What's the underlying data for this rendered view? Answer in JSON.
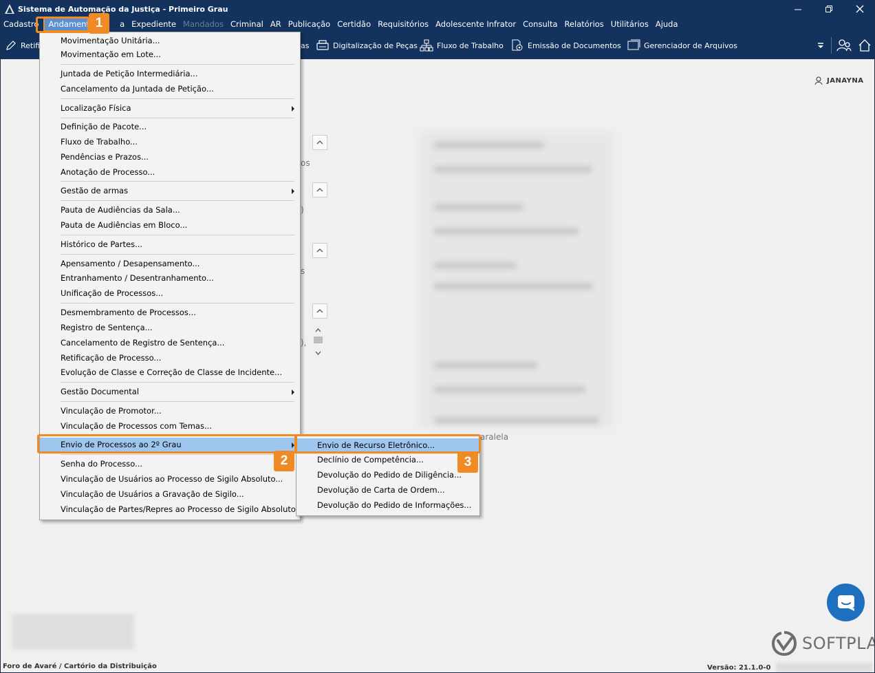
{
  "window": {
    "title": "Sistema de Automação da Justiça - Primeiro Grau",
    "minimize_icon": "minimize-icon",
    "restore_icon": "restore-icon",
    "close_icon": "close-icon"
  },
  "menubar": {
    "items": [
      {
        "label": "Cadastro",
        "state": "normal"
      },
      {
        "label": "Andamento",
        "state": "active"
      },
      {
        "label": "a",
        "state": "normal"
      },
      {
        "label": "Expediente",
        "state": "normal"
      },
      {
        "label": "Mandados",
        "state": "disabled"
      },
      {
        "label": "Criminal",
        "state": "normal"
      },
      {
        "label": "AR",
        "state": "normal"
      },
      {
        "label": "Publicação",
        "state": "normal"
      },
      {
        "label": "Certidão",
        "state": "normal"
      },
      {
        "label": "Requisitórios",
        "state": "normal"
      },
      {
        "label": "Adolescente Infrator",
        "state": "normal"
      },
      {
        "label": "Consulta",
        "state": "normal"
      },
      {
        "label": "Relatórios",
        "state": "normal"
      },
      {
        "label": "Utilitários",
        "state": "normal"
      },
      {
        "label": "Ajuda",
        "state": "normal"
      }
    ]
  },
  "toolbar": {
    "retif_label": "Retifi",
    "partial_label": "as",
    "digitalizacao_label": "Digitalização de Peças",
    "fluxo_label": "Fluxo de Trabalho",
    "emissao_label": "Emissão de Documentos",
    "gerenciador_label": "Gerenciador de Arquivos"
  },
  "user": {
    "name": "JANAYNA"
  },
  "background_fragments": {
    "frag1": "os",
    "frag2": ")",
    "frag3": "s",
    "frag4": "),",
    "frag5": "aralela"
  },
  "andamento_menu": {
    "items": [
      {
        "label": "Movimentação Unitária...",
        "submenu": false
      },
      {
        "label": "Movimentação em Lote...",
        "submenu": false
      },
      {
        "label": "Juntada de Petição Intermediária...",
        "submenu": false
      },
      {
        "label": "Cancelamento da Juntada de Petição...",
        "submenu": false
      },
      {
        "label": "Localização Física",
        "submenu": true
      },
      {
        "label": "Definição de Pacote...",
        "submenu": false
      },
      {
        "label": "Fluxo de Trabalho...",
        "submenu": false
      },
      {
        "label": "Pendências e Prazos...",
        "submenu": false
      },
      {
        "label": "Anotação de Processo...",
        "submenu": false
      },
      {
        "label": "Gestão de armas",
        "submenu": true
      },
      {
        "label": "Pauta de Audiências da Sala...",
        "submenu": false
      },
      {
        "label": "Pauta de Audiências em Bloco...",
        "submenu": false
      },
      {
        "label": "Histórico de Partes...",
        "submenu": false
      },
      {
        "label": "Apensamento / Desapensamento...",
        "submenu": false
      },
      {
        "label": "Entranhamento / Desentranhamento...",
        "submenu": false
      },
      {
        "label": "Unificação de Processos...",
        "submenu": false
      },
      {
        "label": "Desmembramento de Processos...",
        "submenu": false
      },
      {
        "label": "Registro de Sentença...",
        "submenu": false
      },
      {
        "label": "Cancelamento de Registro de Sentença...",
        "submenu": false
      },
      {
        "label": "Retificação de Processo...",
        "submenu": false
      },
      {
        "label": "Evolução de Classe e Correção de Classe de Incidente...",
        "submenu": false
      },
      {
        "label": "Gestão Documental",
        "submenu": true
      },
      {
        "label": "Vinculação de Promotor...",
        "submenu": false
      },
      {
        "label": "Vinculação de Processos com Temas...",
        "submenu": false
      },
      {
        "label": "Envio de Processos ao 2º Grau",
        "submenu": true,
        "highlighted": true
      },
      {
        "label": "Senha do Processo...",
        "submenu": false
      },
      {
        "label": "Vinculação de Usuários ao Processo de Sigilo Absoluto...",
        "submenu": false
      },
      {
        "label": "Vinculação de Usuários a Gravação de Sigilo...",
        "submenu": false
      },
      {
        "label": "Vinculação de Partes/Repres ao Processo de Sigilo Absoluto...",
        "submenu": false
      }
    ]
  },
  "envio_submenu": {
    "items": [
      {
        "label": "Envio de Recurso Eletrônico...",
        "highlighted": true
      },
      {
        "label": "Declínio de Competência..."
      },
      {
        "label": "Devolução do Pedido de Diligência..."
      },
      {
        "label": "Devolução de Carta de Ordem..."
      },
      {
        "label": "Devolução do Pedido de Informações..."
      }
    ]
  },
  "callouts": {
    "step1": "1",
    "step2": "2",
    "step3": "3"
  },
  "colors": {
    "titlebar": "#13325e",
    "callout": "#f08a24",
    "highlight": "#9ec6ef"
  },
  "brand": {
    "name": "SOFTPLAN"
  },
  "status": {
    "location": "Foro de Avaré / Cartório da Distribuição",
    "version": "Versão: 21.1.0-0"
  }
}
